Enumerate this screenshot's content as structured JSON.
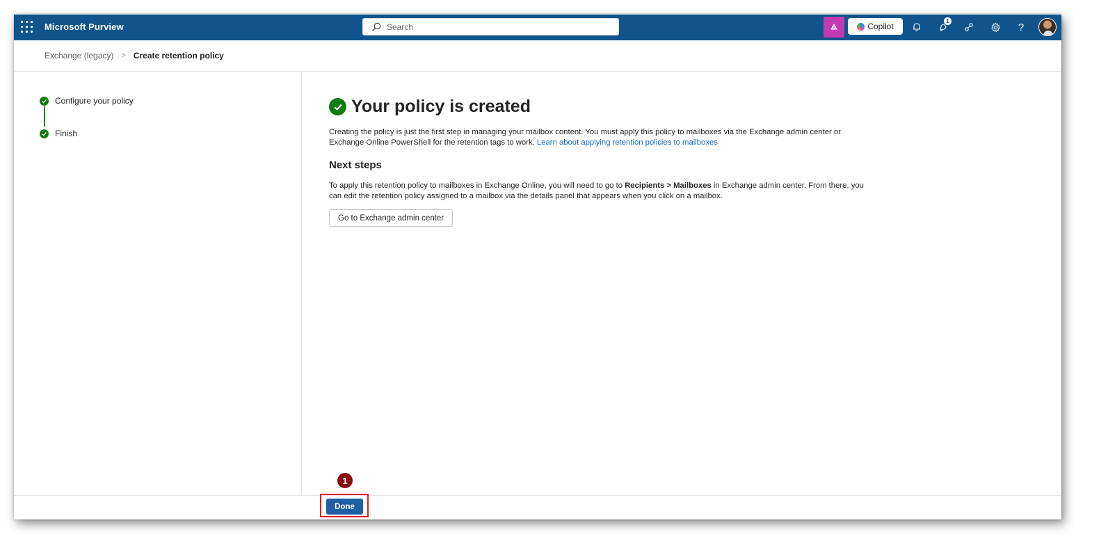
{
  "topbar": {
    "app_title": "Microsoft Purview",
    "search_placeholder": "Search",
    "copilot_label": "Copilot",
    "notification_count": "1",
    "help_label": "?"
  },
  "breadcrumb": {
    "parent": "Exchange (legacy)",
    "separator": ">",
    "current": "Create retention policy"
  },
  "steps": [
    {
      "label": "Configure your policy",
      "status": "complete"
    },
    {
      "label": "Finish",
      "status": "complete"
    }
  ],
  "main": {
    "title": "Your policy is created",
    "intro": "Creating the policy is just the first step in managing your mailbox content. You must apply this policy to mailboxes via the Exchange admin center or Exchange Online PowerShell for the retention tags to work.",
    "intro_link": "Learn about applying retention policies to mailboxes",
    "next_steps_title": "Next steps",
    "next_steps_pre": "To apply this retention policy to mailboxes in Exchange Online, you will need to go to ",
    "next_steps_bold": "Recipients > Mailboxes",
    "next_steps_post": " in Exchange admin center. From there, you can edit the retention policy assigned to a mailbox via the details panel that appears when you click on a mailbox.",
    "exchange_button": "Go to Exchange admin center"
  },
  "footer": {
    "done_label": "Done"
  },
  "annotation": {
    "marker": "1"
  },
  "colors": {
    "topbar": "#0f548c",
    "success": "#107c10",
    "link": "#0f6cbd",
    "primary_button": "#1f5fa8",
    "highlight": "#e01b24",
    "marker": "#8b0d0d",
    "copilot_badge": "#c239b3"
  }
}
